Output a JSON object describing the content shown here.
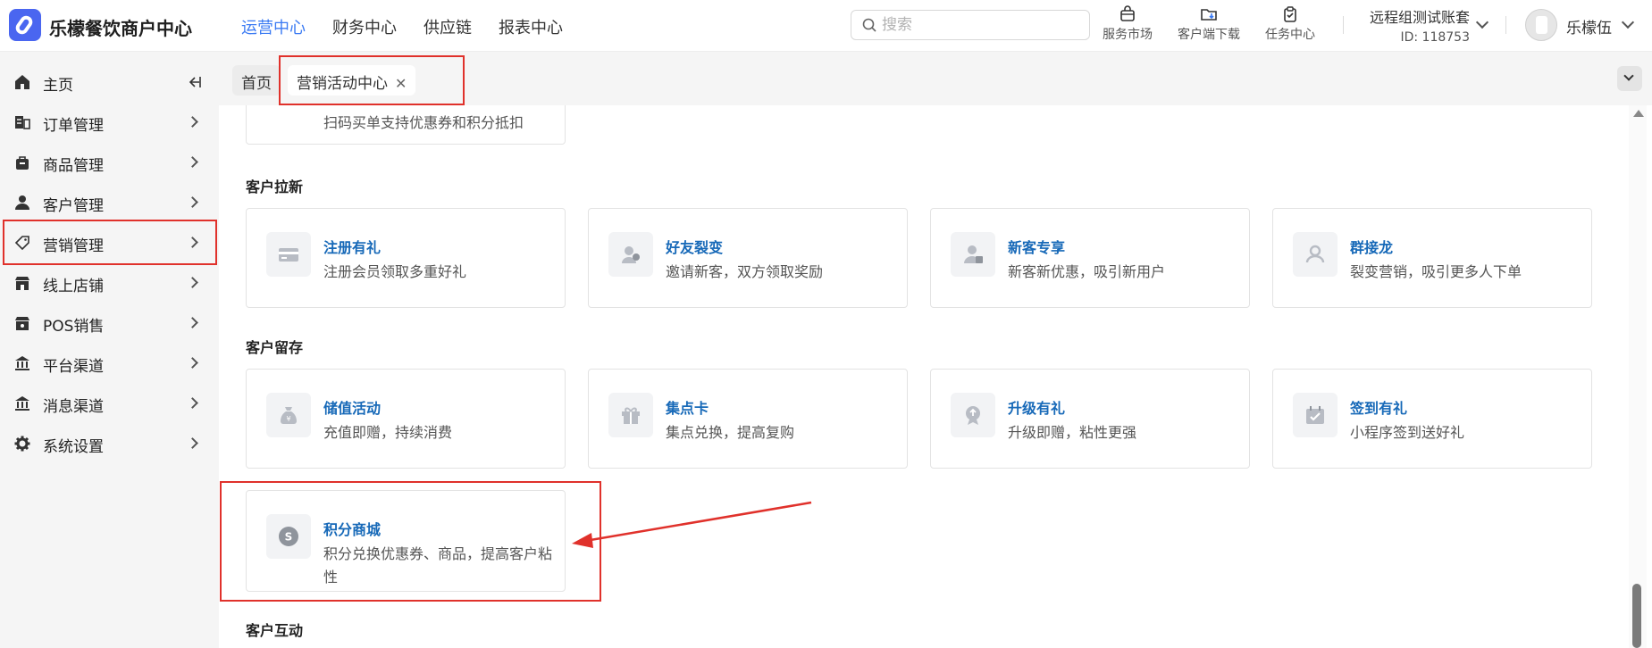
{
  "header": {
    "app_title": "乐檬餐饮商户中心",
    "nav": [
      "运营中心",
      "财务中心",
      "供应链",
      "报表中心"
    ],
    "active_nav": 0,
    "search": {
      "placeholder": "搜索"
    },
    "tools": [
      {
        "label": "服务市场",
        "icon": "store-bag-icon"
      },
      {
        "label": "客户端下载",
        "icon": "folder-download-icon"
      },
      {
        "label": "任务中心",
        "icon": "clipboard-check-icon"
      }
    ],
    "account": {
      "name": "远程组测试账套",
      "id": "ID: 118753"
    },
    "user": {
      "name": "乐檬伍"
    }
  },
  "sidebar": {
    "items": [
      {
        "label": "主页",
        "icon": "home-icon"
      },
      {
        "label": "订单管理",
        "icon": "order-icon"
      },
      {
        "label": "商品管理",
        "icon": "goods-icon"
      },
      {
        "label": "客户管理",
        "icon": "user-icon"
      },
      {
        "label": "营销管理",
        "icon": "tag-icon"
      },
      {
        "label": "线上店铺",
        "icon": "shop-icon"
      },
      {
        "label": "POS销售",
        "icon": "pos-icon"
      },
      {
        "label": "平台渠道",
        "icon": "bank-icon"
      },
      {
        "label": "消息渠道",
        "icon": "message-channel-icon"
      },
      {
        "label": "系统设置",
        "icon": "gear-icon"
      }
    ]
  },
  "tabs": {
    "home": "首页",
    "active": "营销活动中心",
    "close_glyph": "✕"
  },
  "content": {
    "partial_card_desc": "扫码买单支持优惠券和积分抵扣",
    "sections": [
      {
        "title": "客户拉新",
        "cards": [
          {
            "title": "注册有礼",
            "desc": "注册会员领取多重好礼",
            "icon": "card-icon"
          },
          {
            "title": "好友裂变",
            "desc": "邀请新客，双方领取奖励",
            "icon": "friend-icon"
          },
          {
            "title": "新客专享",
            "desc": "新客新优惠，吸引新用户",
            "icon": "new-customer-icon"
          },
          {
            "title": "群接龙",
            "desc": "裂变营销，吸引更多人下单",
            "icon": "group-icon"
          }
        ]
      },
      {
        "title": "客户留存",
        "cards": [
          {
            "title": "储值活动",
            "desc": "充值即赠，持续消费",
            "icon": "money-bag-icon"
          },
          {
            "title": "集点卡",
            "desc": "集点兑换，提高复购",
            "icon": "gift-icon"
          },
          {
            "title": "升级有礼",
            "desc": "升级即赠，粘性更强",
            "icon": "upgrade-icon"
          },
          {
            "title": "签到有礼",
            "desc": "小程序签到送好礼",
            "icon": "calendar-check-icon"
          }
        ]
      },
      {
        "cards": [
          {
            "title": "积分商城",
            "desc": "积分兑换优惠券、商品，提高客户粘性",
            "icon": "points-icon"
          }
        ]
      },
      {
        "title": "客户互动"
      }
    ]
  },
  "colors": {
    "accent": "#3a7af3",
    "card_title": "#1769b8",
    "annotation_red": "#e0312b"
  }
}
